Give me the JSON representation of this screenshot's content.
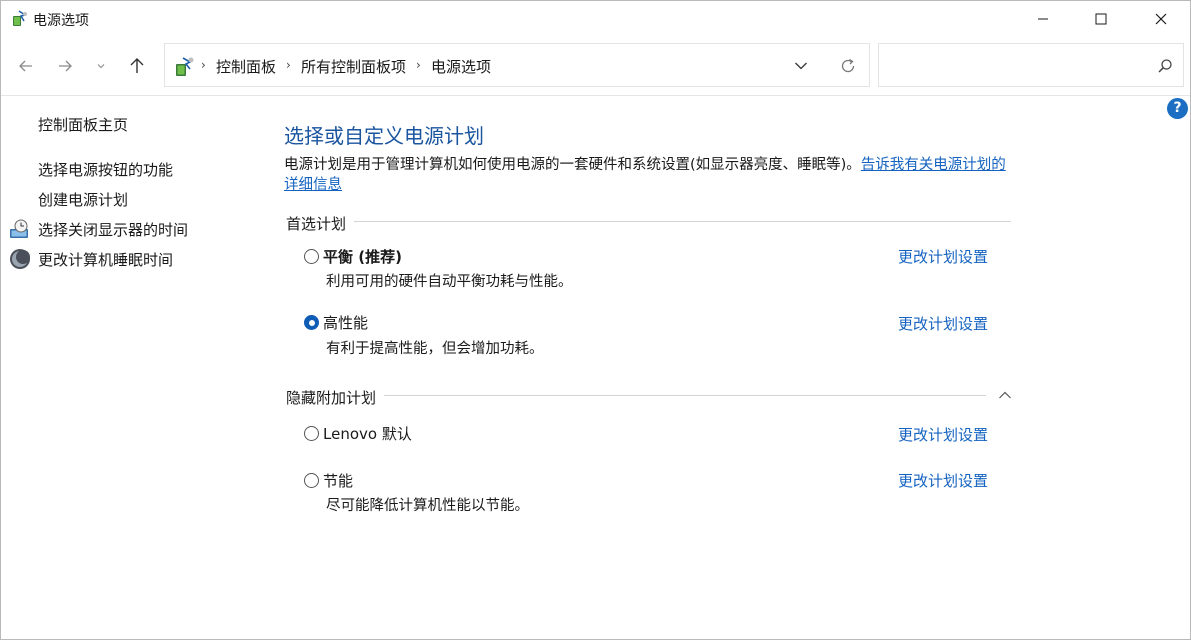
{
  "window": {
    "title": "电源选项",
    "icon": "power-options-icon"
  },
  "navigation": {
    "back_icon": "arrow-left-icon",
    "forward_icon": "arrow-right-icon",
    "recent_icon": "chevron-down-icon",
    "up_icon": "arrow-up-icon",
    "breadcrumb": [
      "控制面板",
      "所有控制面板项",
      "电源选项"
    ],
    "search_placeholder": ""
  },
  "help": {
    "label": "?"
  },
  "sidebar": {
    "home_link": "控制面板主页",
    "links": [
      {
        "label": "选择电源按钮的功能",
        "icon": null
      },
      {
        "label": "创建电源计划",
        "icon": null
      },
      {
        "label": "选择关闭显示器的时间",
        "icon": "display-clock-icon"
      },
      {
        "label": "更改计算机睡眠时间",
        "icon": "moon-icon"
      }
    ]
  },
  "main": {
    "title": "选择或自定义电源计划",
    "description": "电源计划是用于管理计算机如何使用电源的一套硬件和系统设置(如显示器亮度、睡眠等)。",
    "description_link": "告诉我有关电源计划的详细信息",
    "preferred_section": "首选计划",
    "hidden_section": "隐藏附加计划",
    "change_label": "更改计划设置",
    "preferred_plans": [
      {
        "name": "平衡 (推荐)",
        "description": "利用可用的硬件自动平衡功耗与性能。",
        "selected": false
      },
      {
        "name": "高性能",
        "description": "有利于提高性能，但会增加功耗。",
        "selected": true
      }
    ],
    "hidden_plans": [
      {
        "name": "Lenovo 默认",
        "description": "",
        "selected": false
      },
      {
        "name": "节能",
        "description": "尽可能降低计算机性能以节能。",
        "selected": false
      }
    ]
  },
  "colors": {
    "accent": "#1563c0",
    "title": "#1a55a0",
    "help": "#1b6ec2"
  }
}
